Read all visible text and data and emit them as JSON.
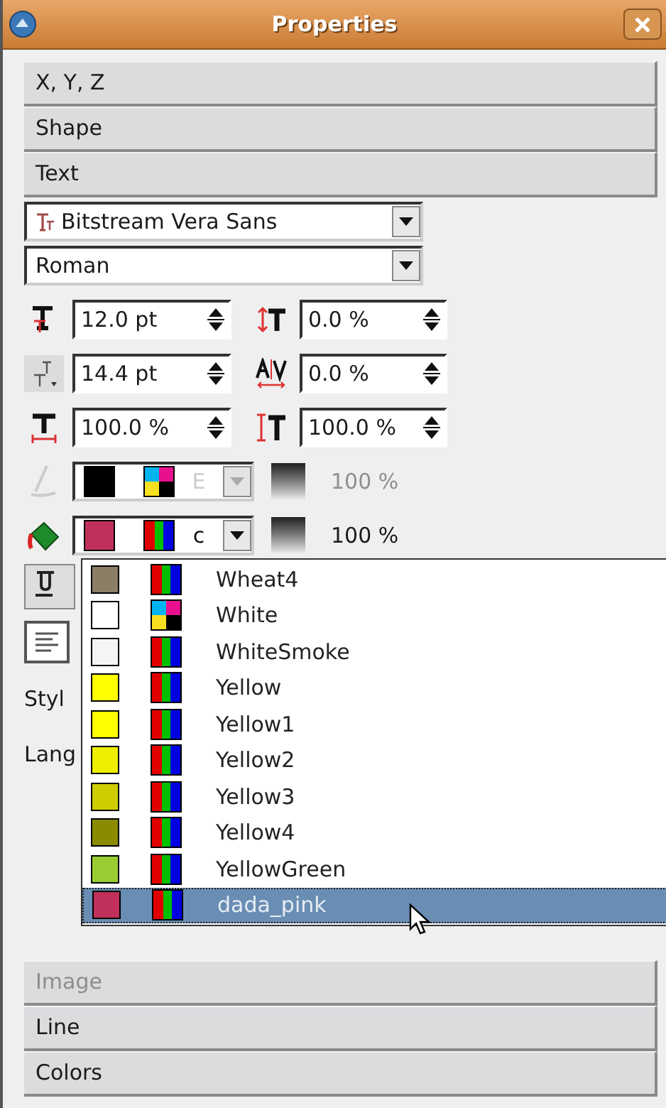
{
  "window": {
    "title": "Properties"
  },
  "sections_top": [
    {
      "label": "X, Y, Z",
      "disabled": false
    },
    {
      "label": "Shape",
      "disabled": false
    },
    {
      "label": "Text",
      "disabled": false
    }
  ],
  "font": {
    "family": "Bitstream Vera Sans",
    "style": "Roman"
  },
  "metrics": [
    {
      "kind": "size",
      "value": "12.0 pt"
    },
    {
      "kind": "offset",
      "value": "0.0 %"
    },
    {
      "kind": "linespacing",
      "value": "14.4 pt"
    },
    {
      "kind": "tracking",
      "value": "0.0 %"
    },
    {
      "kind": "width",
      "value": "100.0 %"
    },
    {
      "kind": "height",
      "value": "100.0 %"
    }
  ],
  "color_rows": [
    {
      "kind": "stroke",
      "disabled": true,
      "color": "#000000",
      "swatch": {
        "kind": "cmyk"
      },
      "name": "E",
      "shade": "100 %"
    },
    {
      "kind": "fill",
      "disabled": false,
      "color": "#c0305a",
      "swatch": {
        "kind": "rgb"
      },
      "name": "c",
      "shade": "100 %"
    }
  ],
  "hidden_labels": [
    "Styl",
    "Lang"
  ],
  "color_list": [
    {
      "name": "Wheat4",
      "color": "#8b7e66",
      "kind": "rgb",
      "selected": false
    },
    {
      "name": "White",
      "color": "#ffffff",
      "kind": "cmyk",
      "selected": false
    },
    {
      "name": "WhiteSmoke",
      "color": "#f5f5f5",
      "kind": "rgb",
      "selected": false
    },
    {
      "name": "Yellow",
      "color": "#ffff00",
      "kind": "rgb",
      "selected": false
    },
    {
      "name": "Yellow1",
      "color": "#ffff00",
      "kind": "rgb",
      "selected": false
    },
    {
      "name": "Yellow2",
      "color": "#eeee00",
      "kind": "rgb",
      "selected": false
    },
    {
      "name": "Yellow3",
      "color": "#cdcd00",
      "kind": "rgb",
      "selected": false
    },
    {
      "name": "Yellow4",
      "color": "#8b8b00",
      "kind": "rgb",
      "selected": false
    },
    {
      "name": "YellowGreen",
      "color": "#9acd32",
      "kind": "rgb",
      "selected": false
    },
    {
      "name": "dada_pink",
      "color": "#c0305a",
      "kind": "rgb",
      "selected": true
    }
  ],
  "sections_bottom": [
    {
      "label": "Image",
      "disabled": true
    },
    {
      "label": "Line",
      "disabled": false
    },
    {
      "label": "Colors",
      "disabled": false
    }
  ]
}
